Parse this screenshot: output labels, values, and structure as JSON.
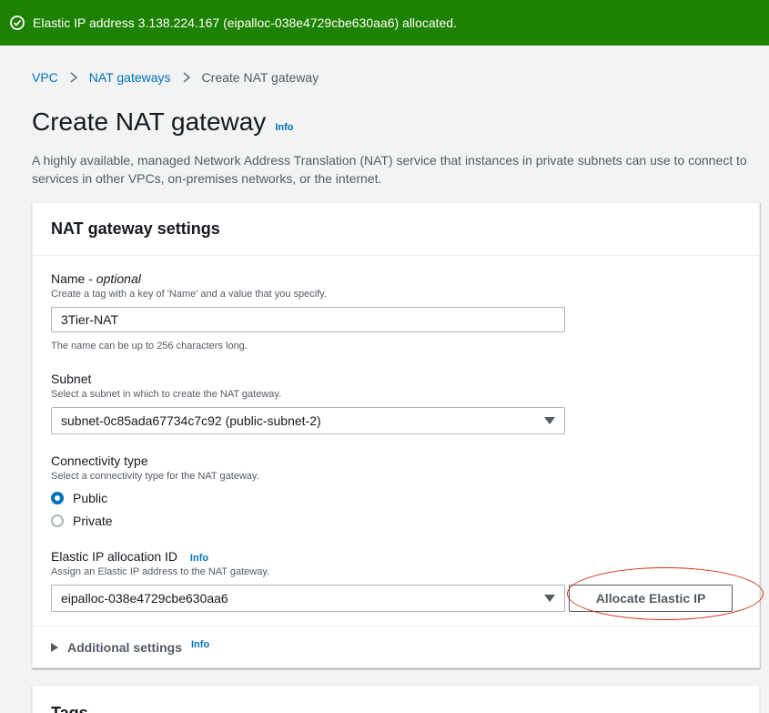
{
  "flash": {
    "message": "Elastic IP address 3.138.224.167 (eipalloc-038e4729cbe630aa6) allocated.",
    "color": "#1d8102"
  },
  "breadcrumb": [
    "VPC",
    "NAT gateways",
    "Create NAT gateway"
  ],
  "page": {
    "title": "Create NAT gateway",
    "info": "Info",
    "description": "A highly available, managed Network Address Translation (NAT) service that instances in private subnets can use to connect to services in other VPCs, on-premises networks, or the internet."
  },
  "settings": {
    "title": "NAT gateway settings",
    "name": {
      "label": "Name -",
      "optional": "optional",
      "hint": "Create a tag with a key of 'Name' and a value that you specify.",
      "value": "3Tier-NAT",
      "constraint": "The name can be up to 256 characters long."
    },
    "subnet": {
      "label": "Subnet",
      "hint": "Select a subnet in which to create the NAT gateway.",
      "value": "subnet-0c85ada67734c7c92 (public-subnet-2)"
    },
    "connectivity": {
      "label": "Connectivity type",
      "hint": "Select a connectivity type for the NAT gateway.",
      "options": [
        "Public",
        "Private"
      ],
      "selected": "Public"
    },
    "eip": {
      "label": "Elastic IP allocation ID",
      "info": "Info",
      "hint": "Assign an Elastic IP address to the NAT gateway.",
      "value": "eipalloc-038e4729cbe630aa6",
      "button": "Allocate Elastic IP"
    },
    "additional": {
      "label": "Additional settings",
      "info": "Info"
    }
  },
  "tags": {
    "title": "Tags"
  }
}
